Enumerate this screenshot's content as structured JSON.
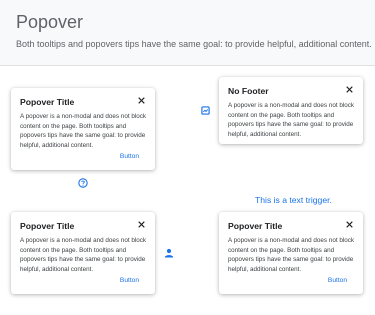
{
  "header": {
    "title": "Popover",
    "subtitle": "Both tooltips and popovers tips have the same goal: to provide helpful, additional content."
  },
  "popovers": [
    {
      "title": "Popover Title",
      "body": "A popover is a non-modal and does not block content on the page. Both tooltips and popovers tips have the same goal: to provide helpful, additional content.",
      "button": "Button",
      "trigger_icon": "help-circle-icon"
    },
    {
      "title": "No Footer",
      "body": "A popover is a non-modal and does not block content on the page. Both tooltips and popovers tips have the same goal: to provide helpful, additional content.",
      "trigger_icon": "chart-square-icon"
    },
    {
      "title": "Popover Title",
      "body": "A popover is a non-modal and does not block content on the page. Both tooltips and popovers tips have the same goal: to provide helpful, additional content.",
      "button": "Button",
      "trigger_icon": "person-icon"
    },
    {
      "title": "Popover Title",
      "body": "A popover is a non-modal and does not block content on the page. Both tooltips and popovers tips have the same goal: to provide helpful, additional content.",
      "button": "Button",
      "trigger_text": "This is a text trigger."
    }
  ],
  "colors": {
    "accent": "#1a73e8",
    "header_bg": "#f8f9fa"
  }
}
